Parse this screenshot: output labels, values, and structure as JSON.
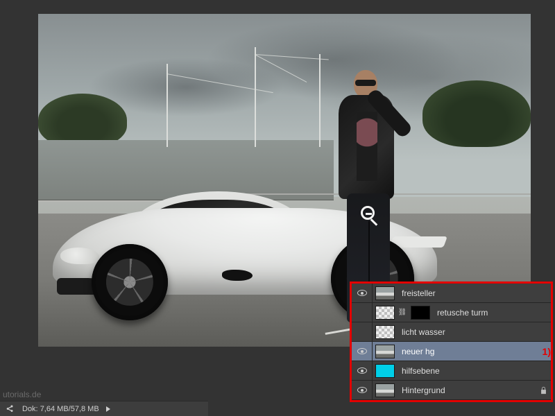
{
  "statusbar": {
    "watermark": "utorials.de",
    "doc_label": "Dok:",
    "doc_size": "7,64 MB/57,8 MB"
  },
  "annotations": {
    "marker1": "1)"
  },
  "layers_panel": {
    "highlight_color": "#e30000",
    "selected_index": 3,
    "rows": [
      {
        "visible": true,
        "thumb": "scene",
        "mask": null,
        "name": "freisteller",
        "locked": false
      },
      {
        "visible": false,
        "thumb": "checker",
        "mask": "plain-black",
        "name": "retusche turm",
        "locked": false
      },
      {
        "visible": false,
        "thumb": "checker",
        "mask": null,
        "name": "licht wasser",
        "locked": false
      },
      {
        "visible": true,
        "thumb": "scene",
        "mask": null,
        "name": "neuer hg",
        "locked": false,
        "annotation": "marker1"
      },
      {
        "visible": true,
        "thumb": "cyan",
        "mask": null,
        "name": "hilfsebene",
        "locked": false
      },
      {
        "visible": true,
        "thumb": "scene",
        "mask": null,
        "name": "Hintergrund",
        "locked": true
      }
    ]
  }
}
